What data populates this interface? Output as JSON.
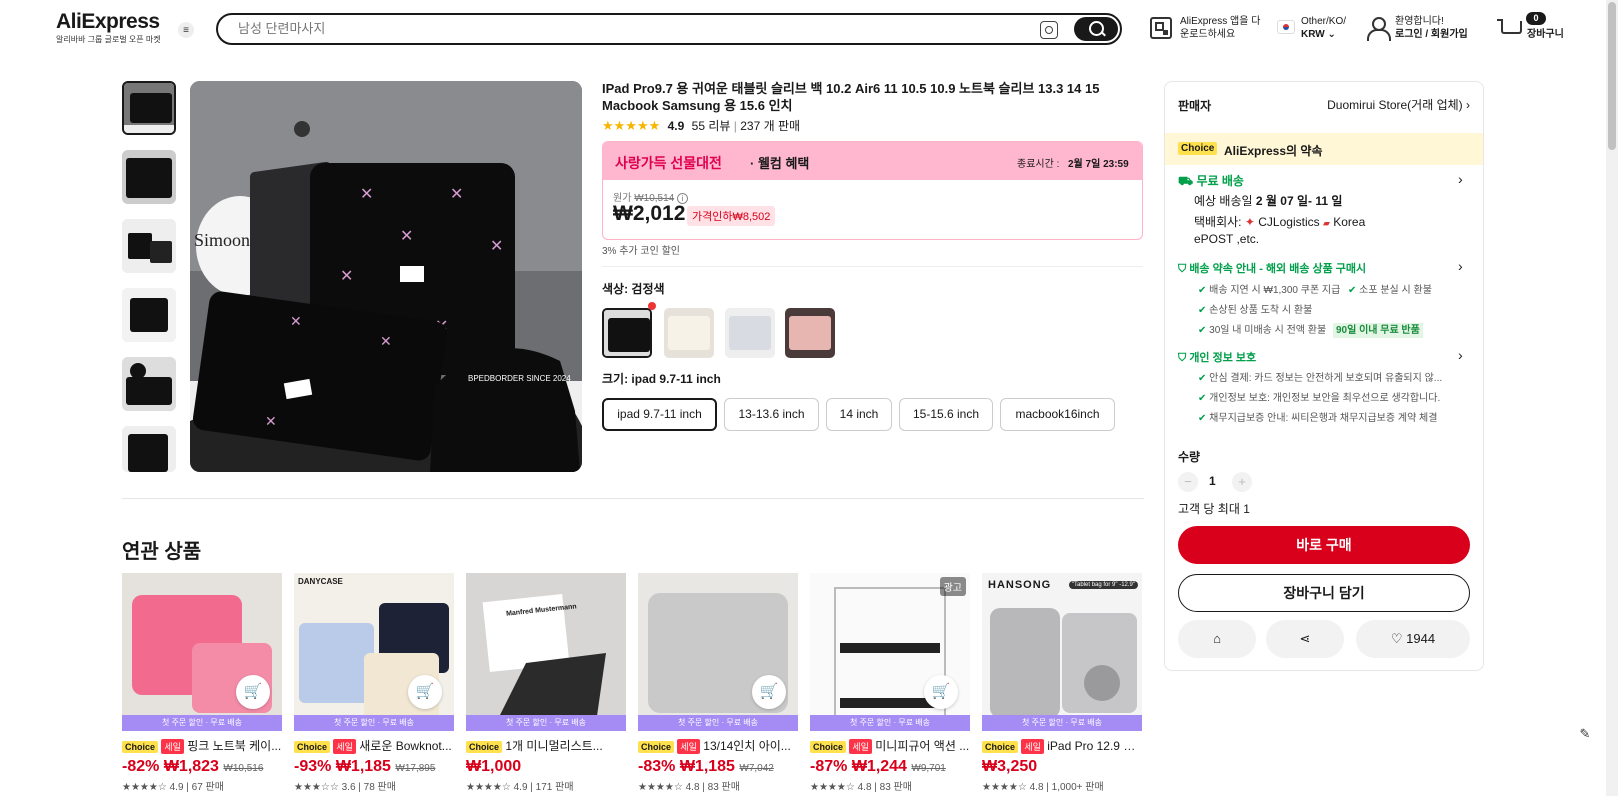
{
  "header": {
    "logo": "AliExpress",
    "logo_sub": "알리바바 그룹 글로벌 오픈 마켓",
    "search_placeholder": "남성 단련마사지",
    "app_line1": "AliExpress 앱을 다",
    "app_line2": "운로드하세요",
    "locale_line1": "Other/KO/",
    "locale_line2": "KRW",
    "welcome_line1": "환영합니다!",
    "welcome_line2": "로그인 / 회원가입",
    "cart_count": "0",
    "cart_label": "장바구니"
  },
  "product": {
    "title": "IPad Pro9.7 용 귀여운 태블릿 슬리브 백 10.2 Air6 11 10.5 10.9 노트북 슬리브 13.3 14 15 Macbook Samsung 용 15.6 인치",
    "rating": "4.9",
    "reviews": "55 리뷰",
    "sold": "237 개 판매",
    "promo_title": "사랑가득 선물대전",
    "promo_benefit": "· 웰컴 혜택",
    "promo_end_label": "종료시간 :",
    "promo_end_time": "2월 7일 23:59",
    "original_label": "원가",
    "original_price": "₩10,514",
    "price": "₩2,012",
    "discount_pill": "가격인하₩8,502",
    "coin_note": "3% 추가 코인 할인",
    "color_label": "색상: 검정색",
    "size_label": "크기: ipad 9.7-11 inch",
    "sizes": [
      "ipad 9.7-11 inch",
      "13-13.6 inch",
      "14 inch",
      "15-15.6 inch",
      "macbook16inch"
    ]
  },
  "seller": {
    "label": "판매자",
    "name": "Duomirui Store(거래 업체)"
  },
  "promise": {
    "choice": "Choice",
    "title": "AliExpress의 약속",
    "free_ship": "무료 배송",
    "est_label": "예상 배송일",
    "est_date": "2 월 07 일- 11 일",
    "courier_label": "택배회사:",
    "courier1": "CJLogistics",
    "courier2": "Korea",
    "courier3": "ePOST ,etc.",
    "guarantee_title": "배송 약속 안내 - 해외 배송 상품 구매시",
    "g1": "배송 지연 시 ₩1,300 쿠폰 지급",
    "g2": "소포 분실 시 환불",
    "g3": "손상된 상품 도착 시 환불",
    "g4": "30일 내 미배송 시 전액 환불",
    "g4_badge": "90일 이내 무료 반품",
    "privacy_title": "개인 정보 보호",
    "p1": "안심 결제: 카드 정보는 안전하게 보호되며 유출되지 않...",
    "p2": "개인정보 보호: 개인정보 보안을 최우선으로 생각합니다.",
    "p3": "채무지급보증 안내: 씨티은행과 채무지급보증 계약 체결"
  },
  "purchase": {
    "qty_label": "수량",
    "qty": "1",
    "limit": "고객 당 최대 1",
    "buy_now": "바로 구매",
    "add_cart": "장바구니 담기",
    "wish_count": "1944"
  },
  "related": {
    "title": "연관 상품",
    "strip": "첫 주문 할인 · 무료 배송",
    "ad": "광고",
    "items": [
      {
        "choice": "Choice",
        "sale": "세일",
        "name": "핑크 노트북 케이...",
        "discount": "-82%",
        "price": "₩1,823",
        "old": "₩10,516",
        "rating": "★★★★☆ 4.9 | 67 판매"
      },
      {
        "choice": "Choice",
        "sale": "세일",
        "name": "새로운 Bowknot...",
        "discount": "-93%",
        "price": "₩1,185",
        "old": "₩17,895",
        "rating": "★★★☆☆ 3.6 | 78 판매"
      },
      {
        "choice": "Choice",
        "sale": "",
        "name": "1개 미니멀리스트...",
        "discount": "",
        "price": "₩1,000",
        "old": "",
        "rating": "★★★★☆ 4.9 | 171 판매"
      },
      {
        "choice": "Choice",
        "sale": "세일",
        "name": "13/14인치 아이...",
        "discount": "-83%",
        "price": "₩1,185",
        "old": "₩7,042",
        "rating": "★★★★☆ 4.8 | 83 판매"
      },
      {
        "choice": "Choice",
        "sale": "세일",
        "name": "미니피규어 액션 ...",
        "discount": "-87%",
        "price": "₩1,244",
        "old": "₩9,701",
        "rating": "★★★★☆ 4.8 | 83 판매"
      },
      {
        "choice": "Choice",
        "sale": "세일",
        "name": "iPad Pro 12.9 용...",
        "discount": "",
        "price": "₩3,250",
        "old": "",
        "rating": "★★★★☆ 4.8 | 1,000+ 판매"
      }
    ],
    "brand_labels": [
      "DANYCASE",
      "Manfred Mustermann",
      "HANSONG",
      "\"Tablet bag for 9\" -12.9\""
    ]
  },
  "image_texts": {
    "main_caption": "Simoon",
    "cap_text": "BPEDBORDER SINCE 2024"
  },
  "colors": {
    "accent": "#d9001b",
    "choice": "#ffe14d",
    "promo_bg": "#ffb7d0",
    "strip": "#a58cf5",
    "green": "#00a04a"
  }
}
